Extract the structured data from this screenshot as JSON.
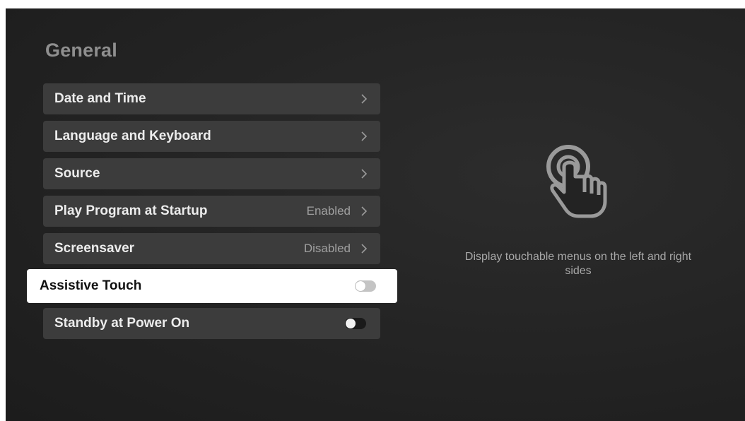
{
  "page": {
    "title": "General"
  },
  "menu": {
    "items": [
      {
        "label": "Date and Time",
        "value": "",
        "control": "chevron"
      },
      {
        "label": "Language and Keyboard",
        "value": "",
        "control": "chevron"
      },
      {
        "label": "Source",
        "value": "",
        "control": "chevron"
      },
      {
        "label": "Play Program at Startup",
        "value": "Enabled",
        "control": "chevron"
      },
      {
        "label": "Screensaver",
        "value": "Disabled",
        "control": "chevron"
      },
      {
        "label": "Assistive Touch",
        "value": "",
        "control": "toggle",
        "toggle_on": false,
        "focused": true
      },
      {
        "label": "Standby at Power On",
        "value": "",
        "control": "toggle",
        "toggle_on": false
      }
    ]
  },
  "hint": {
    "icon": "touch-hand-icon",
    "text": "Display touchable menus on the left and right sides"
  },
  "colors": {
    "background": "#232323",
    "item_background": "#3c3c3c",
    "focused_background": "#ffffff",
    "title_color": "#8f8f8f"
  }
}
